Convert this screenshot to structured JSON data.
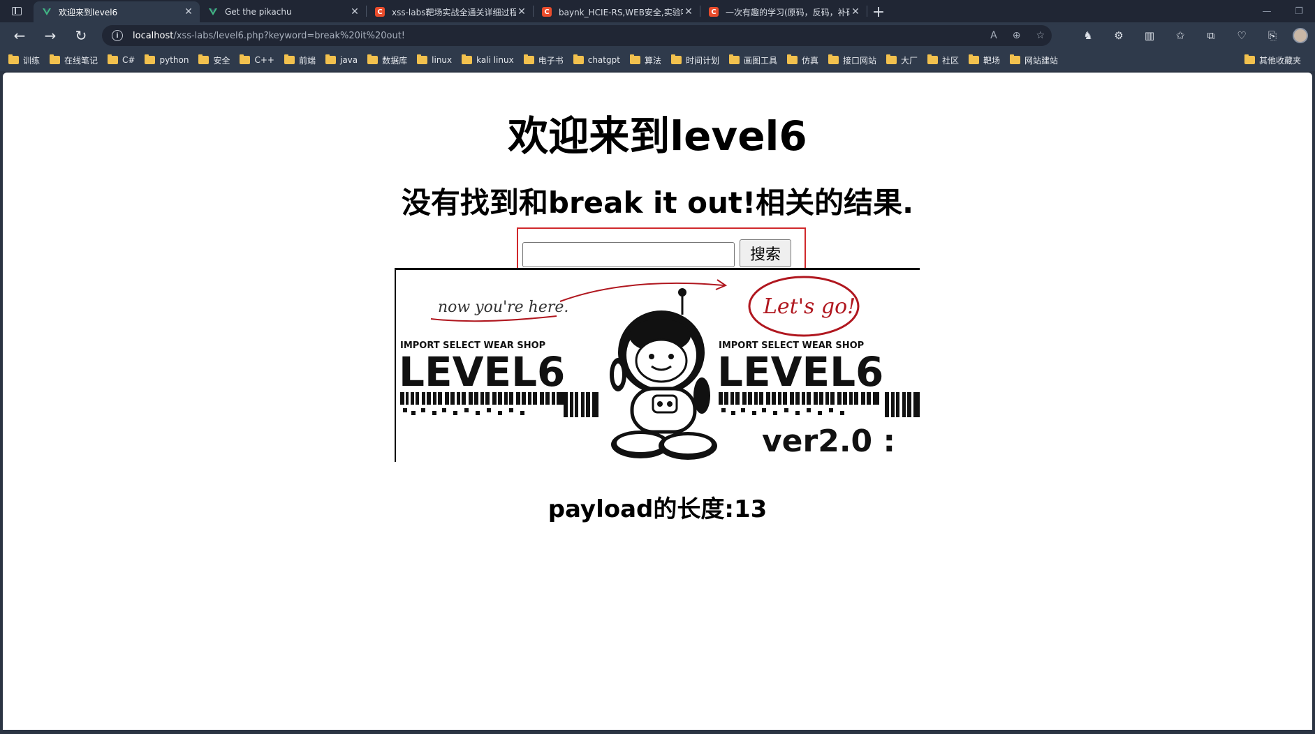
{
  "tabs": [
    {
      "title": "欢迎来到level6",
      "favicon": "vue-icon",
      "active": true
    },
    {
      "title": "Get the pikachu",
      "favicon": "vue-icon",
      "active": false
    },
    {
      "title": "xss-labs靶场实战全通关详细过程",
      "favicon": "csdn-icon",
      "active": false
    },
    {
      "title": "baynk_HCIE-RS,WEB安全,实验吧 W",
      "favicon": "csdn-icon",
      "active": false
    },
    {
      "title": "一次有趣的学习(原码，反码，补码",
      "favicon": "csdn-icon",
      "active": false
    }
  ],
  "address": {
    "host": "localhost",
    "path": "/xss-labs/level6.php?keyword=break%20it%20out!"
  },
  "bookmarks": [
    "训练",
    "在线笔记",
    "C#",
    "python",
    "安全",
    "C++",
    "前端",
    "java",
    "数据库",
    "linux",
    "kali linux",
    "电子书",
    "chatgpt",
    "算法",
    "时间计划",
    "画图工具",
    "仿真",
    "接口网站",
    "大厂",
    "社区",
    "靶场",
    "网站建站"
  ],
  "bookmarks_other": "其他收藏夹",
  "page": {
    "heading": "欢迎来到level6",
    "result": "没有找到和break it out!相关的结果.",
    "search_value": "",
    "search_button": "搜索",
    "payload_length": "payload的长度:13"
  },
  "banner": {
    "left_note": "now you're here.",
    "right_note": "Let's go!",
    "shop_left": "IMPORT SELECT WEAR SHOP",
    "shop_right": "IMPORT SELECT WEAR SHOP",
    "level_left": "LEVEL6",
    "level_right": "LEVEL6",
    "version": "ver2.0 :"
  },
  "colors": {
    "accent_red": "#d0282b",
    "csdn_red": "#e94c2c",
    "vue_green": "#41b883"
  }
}
